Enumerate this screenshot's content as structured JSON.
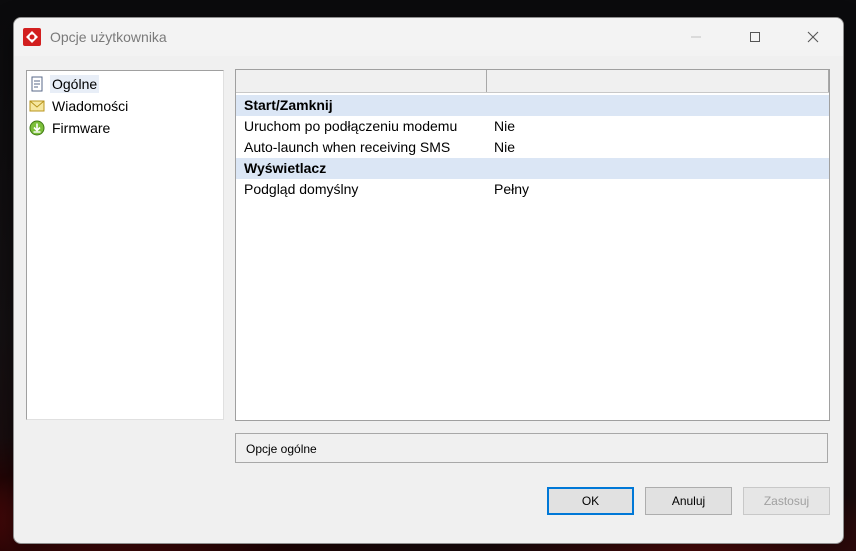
{
  "window": {
    "title": "Opcje użytkownika"
  },
  "tree": {
    "items": [
      {
        "label": "Ogólne",
        "icon": "general-page-icon",
        "selected": true
      },
      {
        "label": "Wiadomości",
        "icon": "envelope-icon",
        "selected": false
      },
      {
        "label": "Firmware",
        "icon": "download-icon",
        "selected": false
      }
    ]
  },
  "grid": {
    "columns": [
      "",
      ""
    ],
    "rows": [
      {
        "type": "category",
        "key": "Start/Zamknij",
        "value": ""
      },
      {
        "type": "property",
        "key": "Uruchom po podłączeniu modemu",
        "value": "Nie"
      },
      {
        "type": "property",
        "key": "Auto-launch when receiving SMS",
        "value": "Nie"
      },
      {
        "type": "category",
        "key": "Wyświetlacz",
        "value": ""
      },
      {
        "type": "property",
        "key": "Podgląd domyślny",
        "value": "Pełny"
      }
    ]
  },
  "description": {
    "text": "Opcje ogólne"
  },
  "buttons": {
    "ok": "OK",
    "cancel": "Anuluj",
    "apply": "Zastosuj"
  },
  "colors": {
    "accent": "#0078d7",
    "category_bg": "#dbe6f5",
    "selected_bg": "#e8eef7"
  }
}
